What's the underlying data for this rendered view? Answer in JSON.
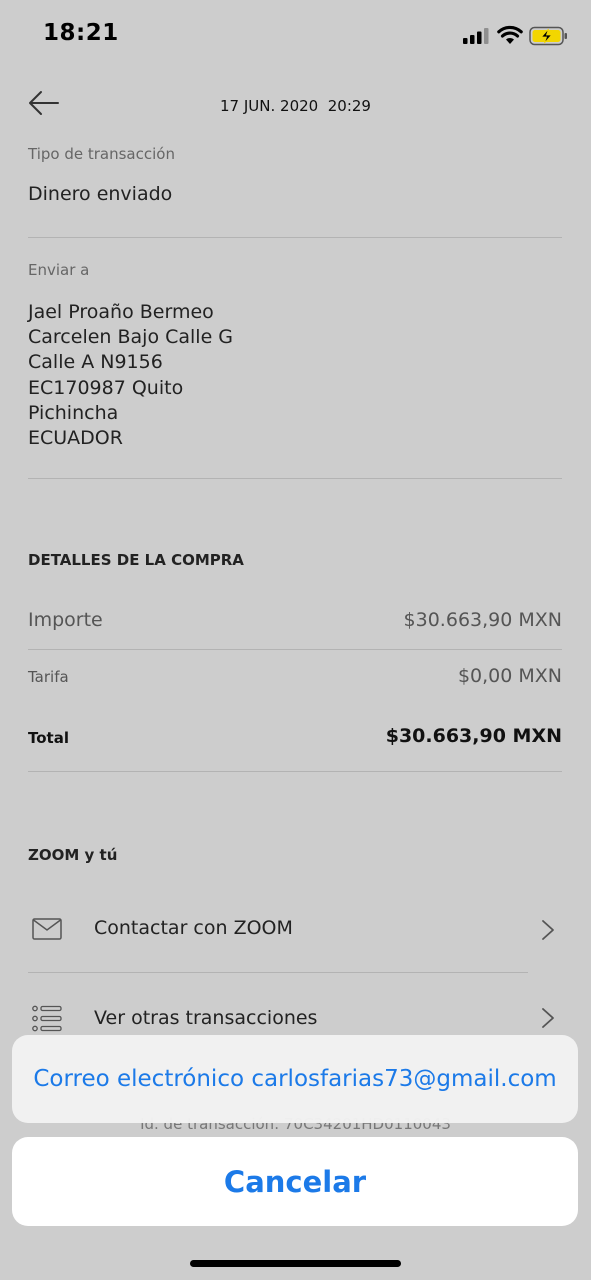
{
  "status_bar": {
    "time": "18:21"
  },
  "header": {
    "date": "17 JUN. 2020  20:29"
  },
  "transaction": {
    "type_label": "Tipo de transacción",
    "type_value": "Dinero enviado",
    "send_to_label": "Enviar a",
    "address_lines": [
      "Jael Proaño Bermeo",
      "Carcelen Bajo Calle G",
      "Calle A N9156",
      "EC170987 Quito",
      "Pichincha",
      "ECUADOR"
    ]
  },
  "purchase": {
    "title": "DETALLES DE LA COMPRA",
    "importe_label": "Importe",
    "importe_value": "$30.663,90 MXN",
    "tarifa_label": "Tarifa",
    "tarifa_value": "$0,00 MXN",
    "total_label": "Total",
    "total_value": "$30.663,90 MXN"
  },
  "zoom": {
    "title": "ZOOM y tú",
    "contact_label": "Contactar con ZOOM",
    "other_label": "Ver otras transacciones"
  },
  "peek_text": "Id. de transacción: 70C34201HD0110043",
  "action_sheet": {
    "email_option": "Correo electrónico carlosfarias73@gmail.com",
    "cancel_label": "Cancelar"
  },
  "colors": {
    "accent": "#1c7ae8",
    "background": "#cdcdcd",
    "battery": "#f2d600"
  }
}
